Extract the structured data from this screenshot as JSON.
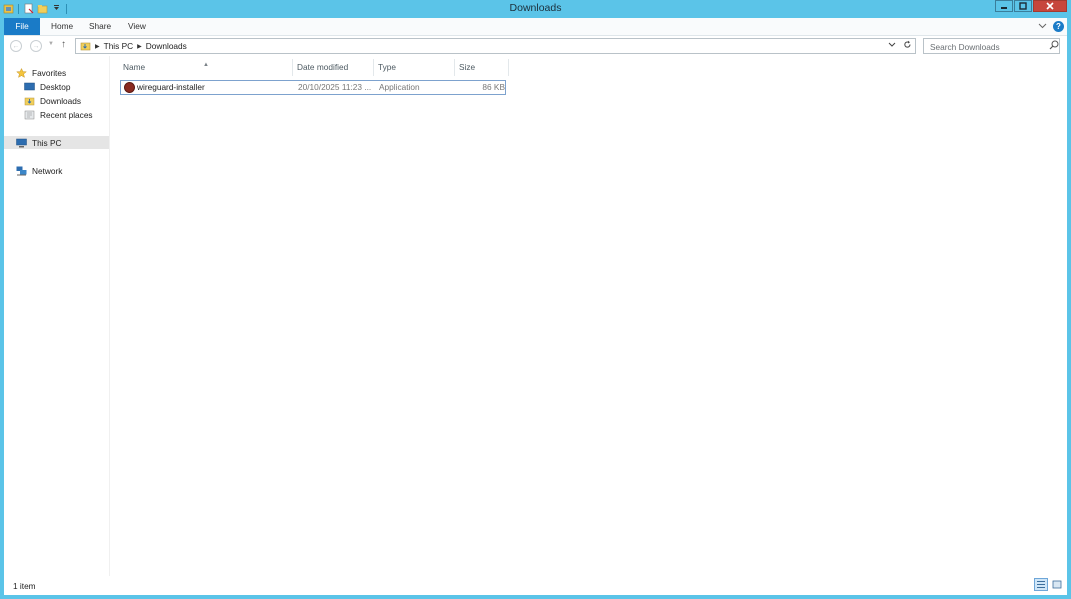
{
  "window": {
    "title": "Downloads"
  },
  "ribbon": {
    "tabs": [
      "File",
      "Home",
      "Share",
      "View"
    ]
  },
  "address": {
    "crumbs": [
      "This PC",
      "Downloads"
    ]
  },
  "search": {
    "placeholder": "Search Downloads"
  },
  "nav": {
    "favorites": "Favorites",
    "desktop": "Desktop",
    "downloads": "Downloads",
    "recent": "Recent places",
    "thispc": "This PC",
    "network": "Network"
  },
  "columns": {
    "name": "Name",
    "date": "Date modified",
    "type": "Type",
    "size": "Size"
  },
  "files": [
    {
      "name": "wireguard-installer",
      "date": "20/10/2025 11:23 ...",
      "type": "Application",
      "size": "86 KB"
    }
  ],
  "status": {
    "count": "1 item"
  },
  "colors": {
    "titlebar": "#5bc4e8",
    "file_tab": "#1a7bc7",
    "close": "#c7463c"
  }
}
